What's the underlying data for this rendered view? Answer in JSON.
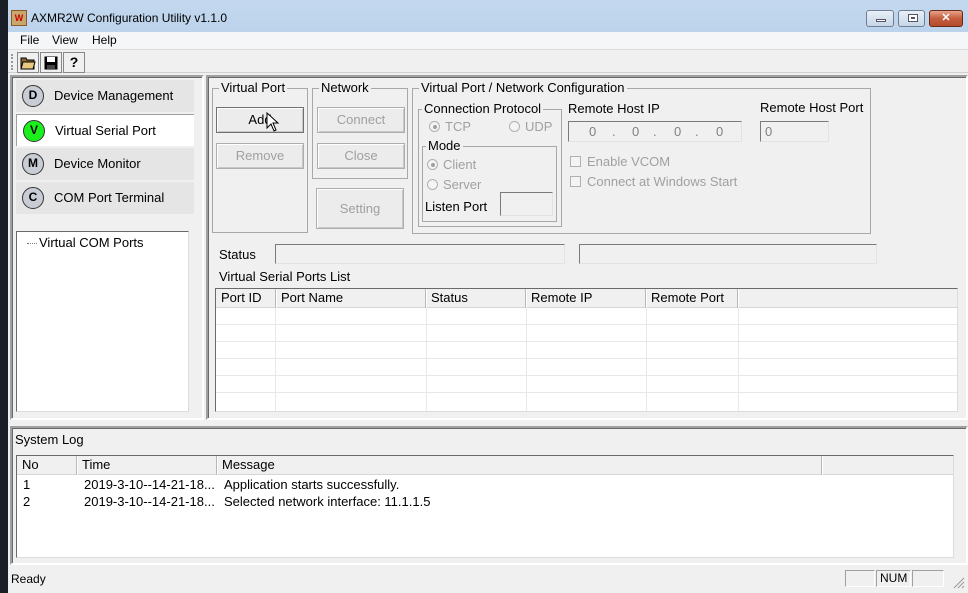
{
  "window": {
    "title": "AXMR2W Configuration Utility v1.1.0",
    "app_icon": "rw-logo-icon",
    "controls": {
      "minimize": "minimize-icon",
      "maximize": "maximize-icon",
      "close": "close-icon"
    }
  },
  "menu": [
    {
      "label": "File"
    },
    {
      "label": "View"
    },
    {
      "label": "Help"
    }
  ],
  "toolbar": [
    {
      "icon": "open-folder-icon",
      "glyph": "📂"
    },
    {
      "icon": "save-icon",
      "glyph": "💾"
    },
    {
      "icon": "help-icon",
      "glyph": "?"
    }
  ],
  "sidebar": {
    "items": [
      {
        "badge": "D",
        "label": "Device Management",
        "active": false
      },
      {
        "badge": "V",
        "label": "Virtual Serial Port",
        "active": true
      },
      {
        "badge": "M",
        "label": "Device Monitor",
        "active": false
      },
      {
        "badge": "C",
        "label": "COM Port Terminal",
        "active": false
      }
    ],
    "tree": {
      "root": "Virtual COM Ports"
    }
  },
  "virtual_port_group": {
    "title": "Virtual Port",
    "add_label": "Add",
    "remove_label": "Remove"
  },
  "network_group": {
    "title": "Network",
    "connect_label": "Connect",
    "close_label": "Close",
    "setting_label": "Setting"
  },
  "config_group": {
    "title": "Virtual Port / Network Configuration",
    "protocol": {
      "title": "Connection Protocol",
      "options": [
        {
          "label": "TCP",
          "selected": true
        },
        {
          "label": "UDP",
          "selected": false
        }
      ]
    },
    "mode": {
      "title": "Mode",
      "options": [
        {
          "label": "Client",
          "selected": true
        },
        {
          "label": "Server",
          "selected": false
        }
      ],
      "listen_port_label": "Listen Port",
      "listen_port_value": ""
    },
    "remote_host_ip_label": "Remote Host IP",
    "remote_host_ip": [
      "0",
      "0",
      "0",
      "0"
    ],
    "ip_separator": ".",
    "remote_host_port_label": "Remote Host Port",
    "remote_host_port": "0",
    "enable_vcom_label": "Enable VCOM",
    "enable_vcom_checked": false,
    "connect_at_start_label": "Connect at Windows Start",
    "connect_at_start_checked": false
  },
  "status": {
    "label": "Status",
    "value1": "",
    "value2": ""
  },
  "ports_list": {
    "title": "Virtual Serial Ports List",
    "columns": [
      "Port ID",
      "Port Name",
      "Status",
      "Remote IP",
      "Remote Port"
    ],
    "rows": []
  },
  "system_log": {
    "title": "System Log",
    "columns": [
      "No",
      "Time",
      "Message"
    ],
    "rows": [
      {
        "no": "1",
        "time": "2019-3-10--14-21-18...",
        "message": "Application starts successfully."
      },
      {
        "no": "2",
        "time": "2019-3-10--14-21-18...",
        "message": "Selected network interface: 11.1.1.5"
      }
    ]
  },
  "statusbar": {
    "text": "Ready",
    "indicators": [
      "",
      "NUM",
      ""
    ]
  }
}
